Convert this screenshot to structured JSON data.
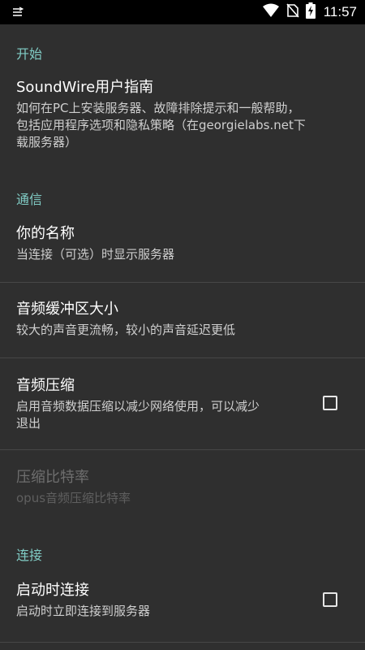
{
  "status_bar": {
    "time": "11:57",
    "icons": [
      "notification-icon",
      "wifi-icon",
      "no-sim-icon",
      "battery-charging-icon"
    ]
  },
  "sections": {
    "start": {
      "header": "开始",
      "guide": {
        "title": "SoundWire用户指南",
        "summary_line1": "如何在PC上安装服务器、故障排除提示和一般帮助，",
        "summary_line2": "包括应用程序选项和隐私策略（在georgielabs.net下",
        "summary_line3": "载服务器）"
      }
    },
    "communication": {
      "header": "通信",
      "your_name": {
        "title": "你的名称",
        "summary": "当连接（可选）时显示服务器"
      },
      "buffer_size": {
        "title": "音频缓冲区大小",
        "summary": "较大的声音更流畅，较小的声音延迟更低"
      },
      "compression": {
        "title": "音频压缩",
        "summary_line1": "启用音频数据压缩以减少网络使用，可以减少",
        "summary_line2": "退出",
        "checked": false
      },
      "bitrate": {
        "title": "压缩比特率",
        "summary": "opus音频压缩比特率",
        "enabled": false
      }
    },
    "connection": {
      "header": "连接",
      "connect_on_start": {
        "title": "启动时连接",
        "summary": "启动时立即连接到服务器",
        "checked": false
      }
    }
  }
}
